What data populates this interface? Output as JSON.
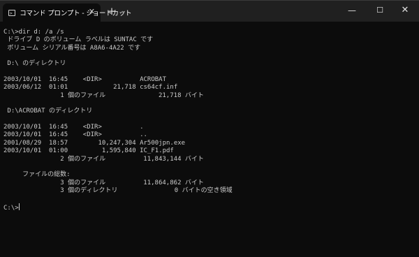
{
  "tab": {
    "icon": "terminal-icon",
    "title": "コマンド プロンプト - ショートカット",
    "close": "✕"
  },
  "toolbar": {
    "new_tab": "+",
    "dropdown": "⌄"
  },
  "window_controls": {
    "minimize": "—",
    "maximize": "☐",
    "close": "✕"
  },
  "colors": {
    "background": "#0c0c0c",
    "titlebar": "#202020",
    "text": "#cccccc"
  },
  "terminal": {
    "lines": [
      "C:\\>dir d: /a /s",
      " ドライブ D のボリューム ラベルは SUNTAC です",
      " ボリューム シリアル番号は A8A6-4A22 です",
      "",
      " D:\\ のディレクトリ",
      "",
      "2003/10/01  16:45    <DIR>          ACROBAT",
      "2003/06/12  01:01            21,718 cs64cf.inf",
      "               1 個のファイル              21,718 バイト",
      "",
      " D:\\ACROBAT のディレクトリ",
      "",
      "2003/10/01  16:45    <DIR>          .",
      "2003/10/01  16:45    <DIR>          ..",
      "2001/08/29  18:57        10,247,304 Ar500jpn.exe",
      "2003/10/01  01:00         1,595,840 IC_F1.pdf",
      "               2 個のファイル          11,843,144 バイト",
      "",
      "     ファイルの総数:",
      "               3 個のファイル          11,864,862 バイト",
      "               3 個のディレクトリ               0 バイトの空き領域",
      "",
      "C:\\>"
    ]
  }
}
